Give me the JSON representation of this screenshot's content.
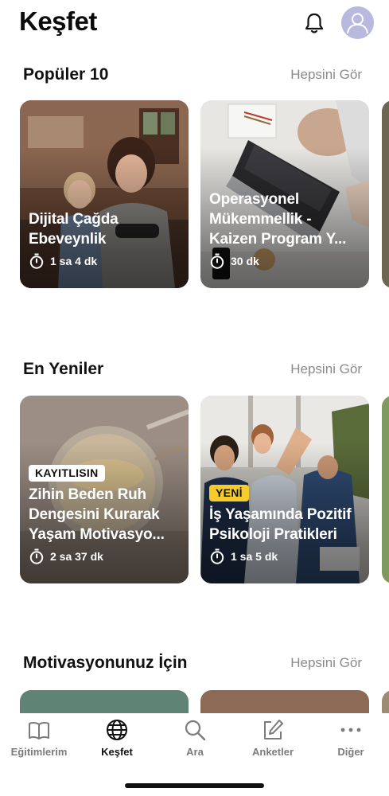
{
  "header": {
    "title": "Keşfet",
    "icons": [
      "bell-icon",
      "avatar-icon"
    ]
  },
  "sections": [
    {
      "title": "Popüler 10",
      "see_all": "Hepsini Gör",
      "cards": [
        {
          "title": "Dijital Çağda Ebeveynlik",
          "duration": "1 sa 4 dk",
          "badge": ""
        },
        {
          "title": "Operasyonel Mükemmellik - Kaizen Program Y...",
          "duration": "30 dk",
          "badge": ""
        }
      ]
    },
    {
      "title": "En Yeniler",
      "see_all": "Hepsini Gör",
      "cards": [
        {
          "title": "Zihin Beden Ruh Dengesini Kurarak Yaşam Motivasyo...",
          "duration": "2 sa 37 dk",
          "badge": "KAYITLISIN"
        },
        {
          "title": "İş Yaşamında Pozitif Psikoloji Pratikleri",
          "duration": "1 sa 5 dk",
          "badge": "YENİ"
        }
      ]
    },
    {
      "title": "Motivasyonunuz İçin",
      "see_all": "Hepsini Gör",
      "cards": []
    }
  ],
  "tabbar": {
    "items": [
      {
        "label": "Eğitimlerim",
        "icon": "book-icon",
        "active": false
      },
      {
        "label": "Keşfet",
        "icon": "globe-icon",
        "active": true
      },
      {
        "label": "Ara",
        "icon": "search-icon",
        "active": false
      },
      {
        "label": "Anketler",
        "icon": "edit-icon",
        "active": false
      },
      {
        "label": "Diğer",
        "icon": "more-icon",
        "active": false
      }
    ]
  },
  "colors": {
    "badge_yellow": "#f5cc2a",
    "avatar_bg": "#b9b8df",
    "muted_text": "#8a8a8a"
  }
}
